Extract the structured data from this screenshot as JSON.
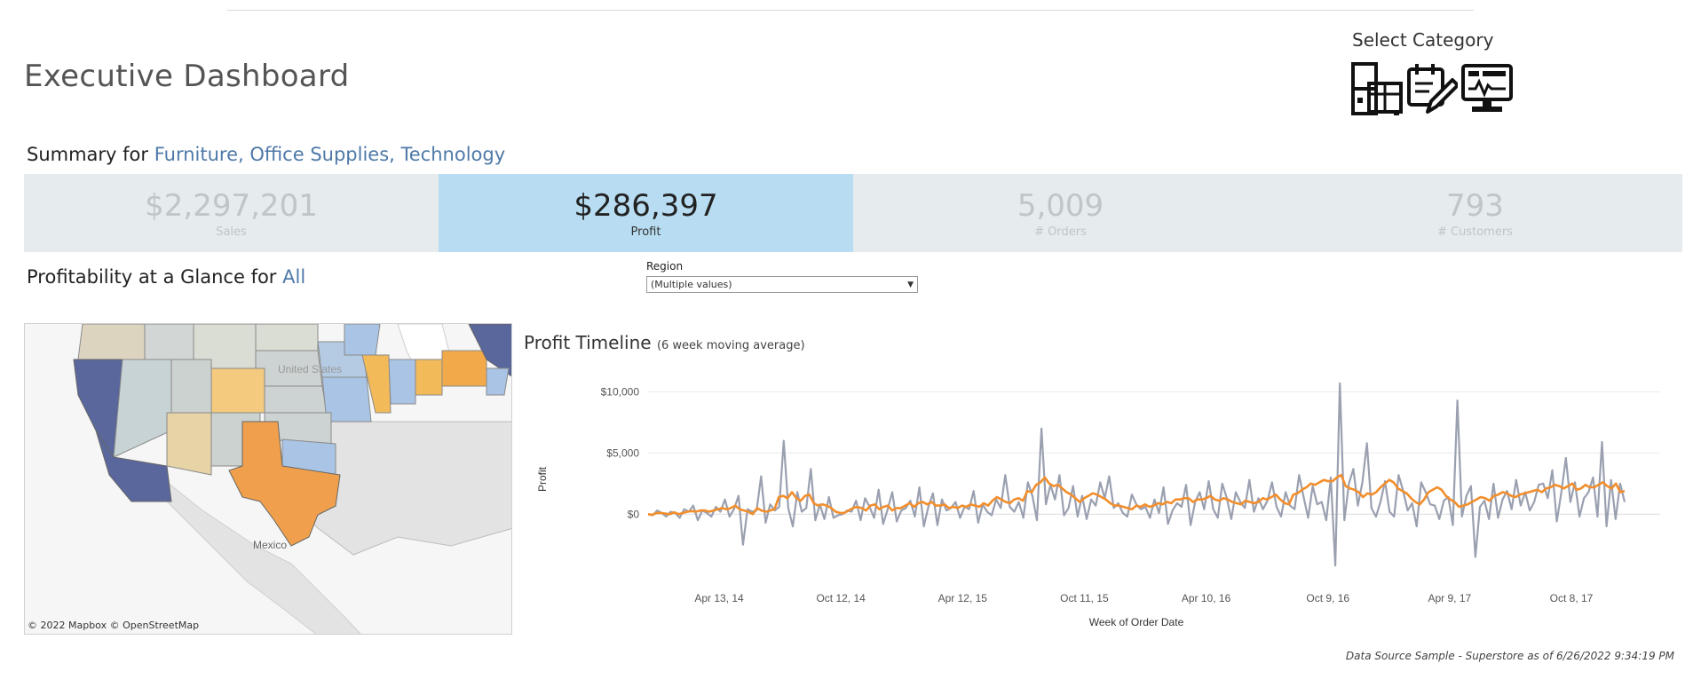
{
  "header": {
    "title": "Executive Dashboard",
    "select_category_label": "Select Category",
    "category_icons": [
      "furniture-icon",
      "office-supplies-icon",
      "technology-icon"
    ]
  },
  "summary": {
    "prefix": "Summary for ",
    "categories": "Furniture, Office Supplies, Technology"
  },
  "kpis": [
    {
      "value": "$2,297,201",
      "label": "Sales",
      "active": false
    },
    {
      "value": "$286,397",
      "label": "Profit",
      "active": true
    },
    {
      "value": "5,009",
      "label": "# Orders",
      "active": false
    },
    {
      "value": "793",
      "label": "# Customers",
      "active": false
    }
  ],
  "glance": {
    "prefix": "Profitability at a Glance for ",
    "value": "All"
  },
  "region_filter": {
    "label": "Region",
    "selected": "(Multiple values)"
  },
  "map": {
    "labels": [
      "United States",
      "Mexico"
    ],
    "credit": "© 2022 Mapbox  © OpenStreetMap"
  },
  "timeline": {
    "title": "Profit Timeline",
    "subtitle": "(6 week moving average)"
  },
  "chart_data": {
    "type": "line",
    "title": "Profit Timeline",
    "subtitle": "(6 week moving average)",
    "xlabel": "Week of Order Date",
    "ylabel": "Profit",
    "x_ticks": [
      "Apr 13, 14",
      "Oct 12, 14",
      "Apr 12, 15",
      "Oct 11, 15",
      "Apr 10, 16",
      "Oct 9, 16",
      "Apr 9, 17",
      "Oct 8, 17"
    ],
    "y_ticks": [
      "$10,000",
      "$5,000",
      "$0"
    ],
    "y_tick_values": [
      10000,
      5000,
      0
    ],
    "ylim": [
      -5500,
      11200
    ],
    "colors": {
      "weekly": "#9aa0b0",
      "moving_avg": "#f28e2b"
    },
    "series": [
      {
        "key": "weekly",
        "values": [
          0,
          -100,
          300,
          100,
          -200,
          200,
          100,
          -300,
          400,
          200,
          700,
          -500,
          300,
          100,
          -200,
          600,
          200,
          1200,
          -200,
          400,
          1500,
          -2500,
          400,
          200,
          300,
          3100,
          -700,
          800,
          300,
          600,
          6000,
          500,
          -1000,
          1800,
          200,
          500,
          3700,
          -500,
          800,
          -400,
          1400,
          -300,
          -100,
          0,
          300,
          200,
          1100,
          -500,
          1300,
          600,
          -300,
          2000,
          -800,
          400,
          1800,
          -600,
          300,
          500,
          1100,
          -200,
          2200,
          -1000,
          600,
          1700,
          -900,
          1200,
          300,
          500,
          1000,
          -300,
          600,
          400,
          1900,
          -700,
          800,
          200,
          -100,
          1200,
          500,
          3200,
          600,
          200,
          1000,
          -300,
          2600,
          1500,
          -500,
          7000,
          800,
          2400,
          1200,
          3200,
          -100,
          500,
          2300,
          -200,
          1500,
          -400,
          1200,
          700,
          2600,
          1300,
          3100,
          500,
          900,
          100,
          -200,
          1600,
          800,
          400,
          600,
          -300,
          1200,
          100,
          2200,
          -800,
          300,
          900,
          600,
          2400,
          -900,
          1000,
          1800,
          400,
          2700,
          400,
          -300,
          2500,
          1300,
          -400,
          1800,
          1000,
          500,
          2800,
          200,
          1300,
          400,
          1100,
          2600,
          600,
          -200,
          1800,
          700,
          400,
          3200,
          1400,
          -300,
          2300,
          800,
          1000,
          -500,
          3000,
          -4200,
          10700,
          -500,
          2500,
          3700,
          700,
          2600,
          5800,
          500,
          -200,
          1000,
          2700,
          200,
          -200,
          3200,
          1900,
          300,
          900,
          -1000,
          2600,
          1800,
          800,
          700,
          -400,
          1100,
          1400,
          -900,
          9300,
          -200,
          1500,
          2300,
          -3500,
          600,
          1100,
          -400,
          2500,
          -300,
          1200,
          1900,
          400,
          2800,
          700,
          1800,
          300,
          1000,
          2400,
          2500,
          1300,
          3600,
          -600,
          1800,
          4600,
          1000,
          2600,
          -200,
          1300,
          1800,
          3000,
          -200,
          5900,
          -1000,
          2800,
          -400,
          2500,
          1000
        ]
      },
      {
        "key": "moving_avg",
        "values": [
          0,
          -50,
          100,
          100,
          50,
          0,
          150,
          0,
          100,
          200,
          250,
          200,
          300,
          300,
          200,
          300,
          400,
          500,
          400,
          500,
          700,
          400,
          300,
          200,
          0,
          500,
          300,
          200,
          300,
          400,
          1400,
          1500,
          1300,
          1800,
          1300,
          1100,
          1500,
          1600,
          900,
          700,
          800,
          700,
          500,
          200,
          100,
          100,
          300,
          500,
          600,
          500,
          300,
          700,
          800,
          400,
          600,
          700,
          300,
          500,
          500,
          700,
          900,
          600,
          900,
          1000,
          800,
          1000,
          700,
          700,
          800,
          500,
          600,
          500,
          700,
          600,
          800,
          700,
          600,
          900,
          700,
          1100,
          1400,
          1200,
          1000,
          900,
          1200,
          1300,
          1100,
          1900,
          1800,
          2400,
          2600,
          3000,
          2500,
          2300,
          2400,
          2100,
          1800,
          1600,
          1300,
          1000,
          1300,
          1500,
          1700,
          1600,
          1400,
          1200,
          900,
          700,
          700,
          600,
          500,
          400,
          700,
          600,
          800,
          600,
          700,
          900,
          800,
          1000,
          900,
          1200,
          1200,
          1300,
          1300,
          1000,
          1200,
          1200,
          1300,
          1500,
          1200,
          1100,
          1300,
          1200,
          1000,
          900,
          800,
          1100,
          1000,
          900,
          1000,
          1300,
          1200,
          1400,
          1600,
          1200,
          900,
          800,
          1600,
          1700,
          2000,
          2200,
          2500,
          2400,
          2600,
          2800,
          2700,
          2700,
          3000,
          3200,
          2300,
          2100,
          2000,
          1800,
          1400,
          1700,
          1600,
          1800,
          2200,
          2500,
          2800,
          2600,
          2100,
          1900,
          1700,
          1300,
          1000,
          800,
          1200,
          1800,
          2000,
          2200,
          2000,
          1500,
          1200,
          1000,
          600,
          700,
          800,
          1000,
          1200,
          1400,
          1300,
          1100,
          1500,
          1600,
          1800,
          1700,
          1500,
          1400,
          1600,
          1700,
          1800,
          1900,
          2000,
          1800,
          2100,
          2200,
          2400,
          2300,
          2100,
          2300,
          2500,
          2000,
          2100,
          2400,
          2200,
          2200,
          2400,
          2600,
          2300,
          2100,
          2500,
          1800,
          1900
        ]
      }
    ]
  },
  "footer": {
    "text": "Data Source Sample - Superstore as of 6/26/2022 9:34:19 PM"
  }
}
